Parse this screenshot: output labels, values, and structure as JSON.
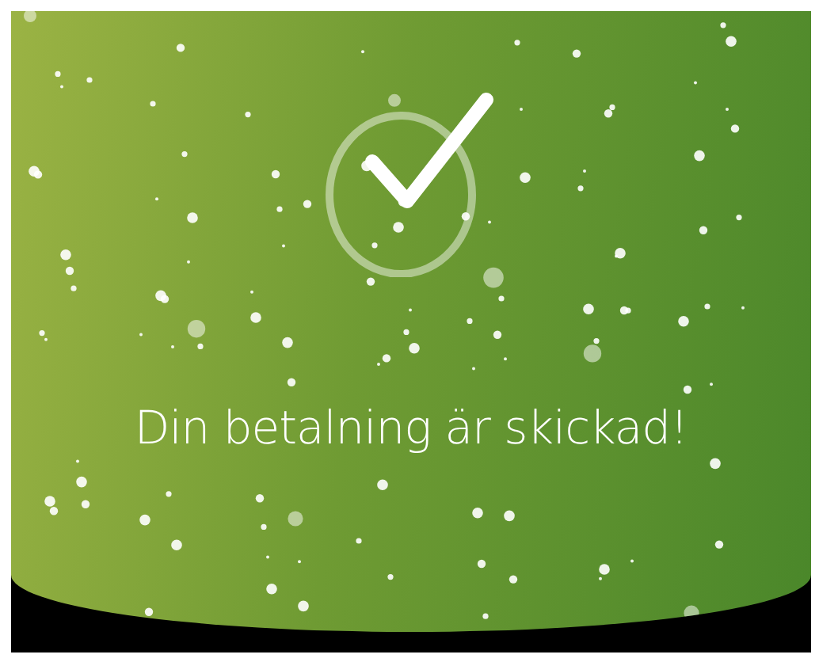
{
  "confirmation": {
    "message": "Din betalning är skickad!"
  }
}
